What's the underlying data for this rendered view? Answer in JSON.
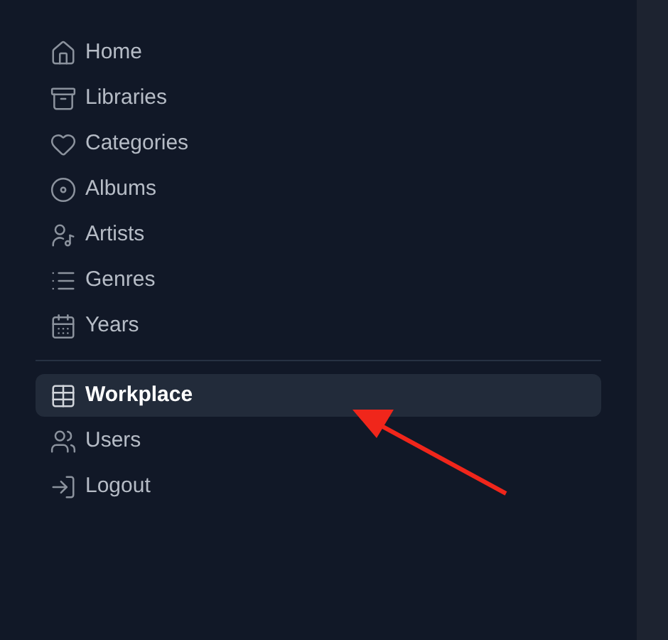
{
  "sidebar": {
    "sections": [
      {
        "items": [
          {
            "label": "Home",
            "selected": false
          },
          {
            "label": "Libraries",
            "selected": false
          },
          {
            "label": "Categories",
            "selected": false
          },
          {
            "label": "Albums",
            "selected": false
          },
          {
            "label": "Artists",
            "selected": false
          },
          {
            "label": "Genres",
            "selected": false
          },
          {
            "label": "Years",
            "selected": false
          }
        ]
      },
      {
        "items": [
          {
            "label": "Workplace",
            "selected": true
          },
          {
            "label": "Users",
            "selected": false
          },
          {
            "label": "Logout",
            "selected": false
          }
        ]
      }
    ]
  }
}
